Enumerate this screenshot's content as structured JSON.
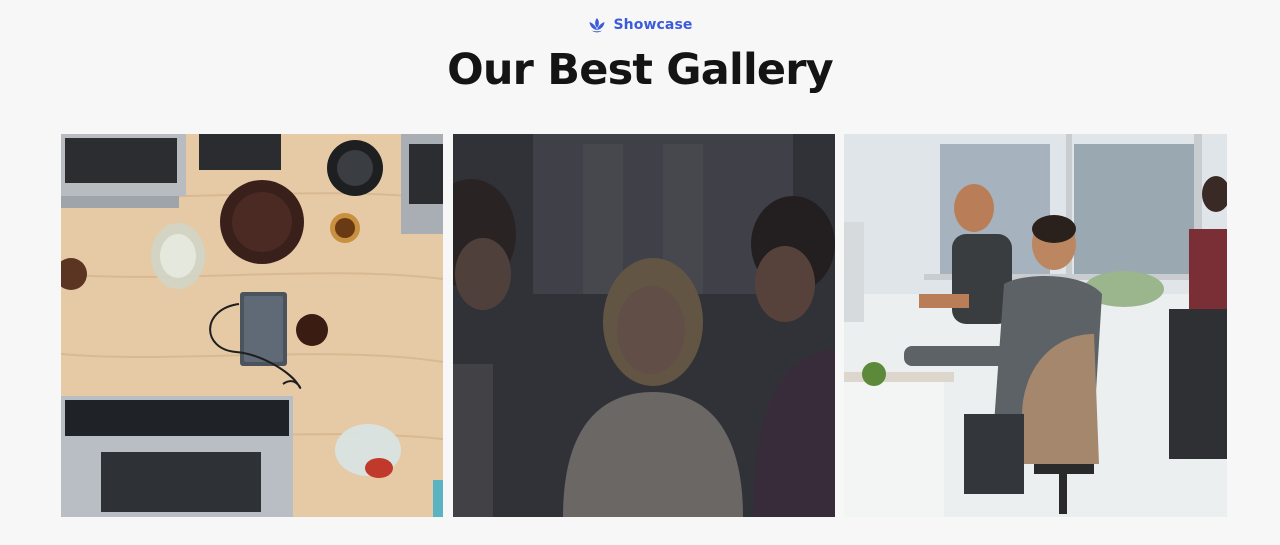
{
  "header": {
    "eyebrow_label": "Showcase",
    "eyebrow_icon": "lotus-leaf-icon",
    "title": "Our Best Gallery",
    "accent_color": "#3b5bdb"
  },
  "gallery": {
    "items": [
      {
        "name": "desk-with-laptops-photo"
      },
      {
        "name": "team-looking-at-screen-photo",
        "state": "hover-overlay"
      },
      {
        "name": "office-meeting-photo"
      }
    ]
  }
}
